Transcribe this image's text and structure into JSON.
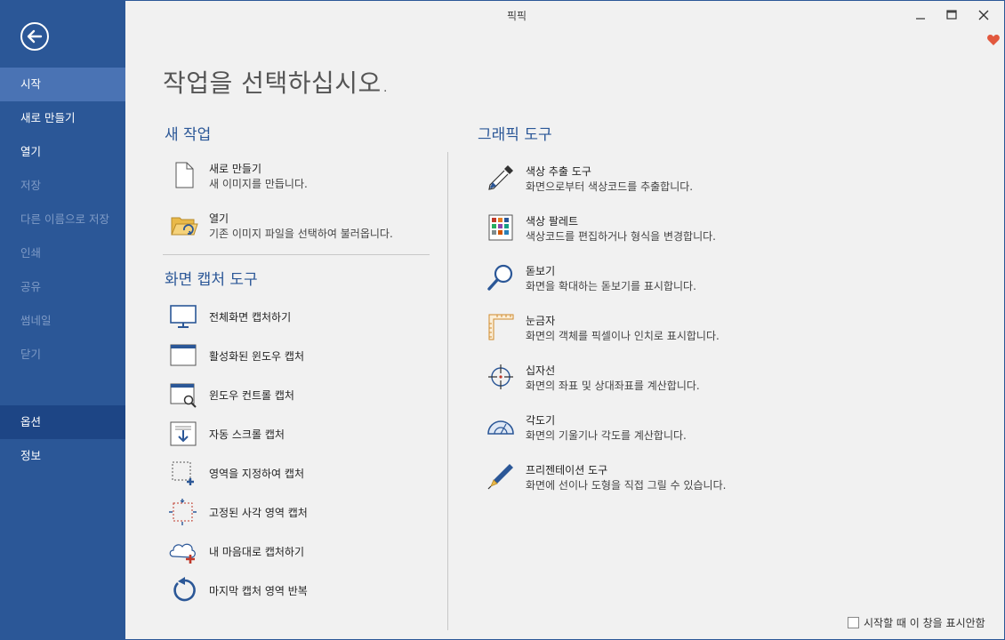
{
  "app": {
    "title": "픽픽"
  },
  "colors": {
    "sidebar": "#2b5797",
    "sidebar_active": "#4a73b4",
    "sidebar_pressed": "#1d4585",
    "accent": "#2b5797",
    "heart": "#e2583e"
  },
  "sidebar": {
    "back_icon": "back-arrow-icon",
    "items": [
      {
        "label": "시작",
        "state": "active"
      },
      {
        "label": "새로 만들기",
        "state": "normal"
      },
      {
        "label": "열기",
        "state": "normal"
      },
      {
        "label": "저장",
        "state": "disabled"
      },
      {
        "label": "다른 이름으로 저장",
        "state": "disabled"
      },
      {
        "label": "인쇄",
        "state": "disabled"
      },
      {
        "label": "공유",
        "state": "disabled"
      },
      {
        "label": "썸네일",
        "state": "disabled"
      },
      {
        "label": "닫기",
        "state": "disabled"
      },
      {
        "label": "옵션",
        "state": "pressed"
      },
      {
        "label": "정보",
        "state": "normal"
      }
    ]
  },
  "main": {
    "heading": "작업을 선택하십시오.",
    "new_task": {
      "title": "새 작업",
      "items": [
        {
          "title": "새로 만들기",
          "desc": "새 이미지를 만듭니다.",
          "icon": "blank-document-icon"
        },
        {
          "title": "열기",
          "desc": "기존 이미지 파일을 선택하여 불러옵니다.",
          "icon": "open-folder-icon"
        }
      ]
    },
    "capture": {
      "title": "화면 캡처 도구",
      "items": [
        {
          "label": "전체화면 캡처하기",
          "icon": "monitor-icon"
        },
        {
          "label": "활성화된 윈도우 캡처",
          "icon": "active-window-icon"
        },
        {
          "label": "윈도우 컨트롤 캡처",
          "icon": "window-control-icon"
        },
        {
          "label": "자동 스크롤 캡처",
          "icon": "scroll-capture-icon"
        },
        {
          "label": "영역을 지정하여 캡처",
          "icon": "region-capture-icon"
        },
        {
          "label": "고정된 사각 영역 캡처",
          "icon": "fixed-region-icon"
        },
        {
          "label": "내 마음대로 캡처하기",
          "icon": "freehand-capture-icon"
        },
        {
          "label": "마지막 캡처 영역 반복",
          "icon": "repeat-capture-icon"
        }
      ]
    },
    "graphics": {
      "title": "그래픽 도구",
      "items": [
        {
          "title": "색상 추출 도구",
          "desc": "화면으로부터 색상코드를 추출합니다.",
          "icon": "eyedropper-icon"
        },
        {
          "title": "색상 팔레트",
          "desc": "색상코드를 편집하거나 형식을 변경합니다.",
          "icon": "color-palette-icon"
        },
        {
          "title": "돋보기",
          "desc": "화면을 확대하는 돋보기를 표시합니다.",
          "icon": "magnifier-icon"
        },
        {
          "title": "눈금자",
          "desc": "화면의 객체를 픽셀이나 인치로 표시합니다.",
          "icon": "ruler-icon"
        },
        {
          "title": "십자선",
          "desc": "화면의 좌표 및 상대좌표를 계산합니다.",
          "icon": "crosshair-icon"
        },
        {
          "title": "각도기",
          "desc": "화면의 기울기나 각도를 계산합니다.",
          "icon": "protractor-icon"
        },
        {
          "title": "프리젠테이션 도구",
          "desc": "화면에 선이나 도형을 직접 그릴 수 있습니다.",
          "icon": "pen-icon"
        }
      ]
    }
  },
  "footer": {
    "checkbox_label": "시작할 때 이 창을 표시안함",
    "checked": false
  }
}
